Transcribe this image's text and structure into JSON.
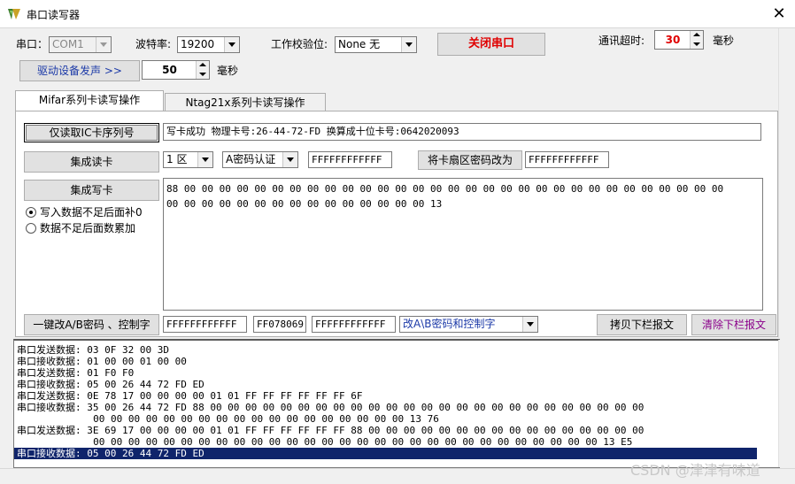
{
  "window": {
    "title": "串口读写器",
    "close_symbol": "✕"
  },
  "serial": {
    "port_label": "串口：",
    "port_value": "COM1",
    "baud_label": "波特率:",
    "baud_value": "19200",
    "parity_label": "工作校验位:",
    "parity_value": "None  无",
    "close_port_label": "关闭串口"
  },
  "timeout": {
    "label": "通讯超时:",
    "value": "30",
    "unit": "毫秒"
  },
  "beep": {
    "button_label": "驱动设备发声 >>",
    "value": "50",
    "unit": "毫秒"
  },
  "tabs": [
    {
      "label": "Mifar系列卡读写操作"
    },
    {
      "label": "Ntag21x系列卡读写操作"
    }
  ],
  "mifare": {
    "read_serial_label": "仅读取IC卡序列号",
    "result_text": "写卡成功 物理卡号:26-44-72-FD 换算成十位卡号:0642020093",
    "read_card_label": "集成读卡",
    "sector_value": "1 区",
    "auth_value": "A密码认证",
    "key_value": "FFFFFFFFFFFF",
    "change_key_label": "将卡扇区密码改为",
    "new_key_value": "FFFFFFFFFFFF",
    "write_card_label": "集成写卡",
    "data_line1": "88 00 00 00 00 00 00 00 00 00 00 00 00 00 00 00 00 00 00 00 00 00 00 00 00 00 00 00 00 00 00 00",
    "data_line2": "00 00 00 00 00 00 00 00 00 00 00 00 00 00 00 13",
    "radio_pad_label": "写入数据不足后面补0",
    "radio_inc_label": "数据不足后面数累加",
    "change_ab_label": "一键改A/B密码 、控制字",
    "key_a_value": "FFFFFFFFFFFF",
    "control_value": "FF078069",
    "key_b_value": "FFFFFFFFFFFF",
    "change_mode_value": "改A\\B密码和控制字",
    "copy_log_label": "拷贝下栏报文",
    "clear_log_label": "清除下栏报文"
  },
  "log": {
    "lines": [
      "串口发送数据: 03 0F 32 00 3D",
      "串口接收数据: 01 00 00 01 00 00",
      "串口发送数据: 01 F0 F0",
      "串口接收数据: 05 00 26 44 72 FD ED",
      "串口发送数据: 0E 78 17 00 00 00 00 01 01 FF FF FF FF FF FF 6F",
      "串口接收数据: 35 00 26 44 72 FD 88 00 00 00 00 00 00 00 00 00 00 00 00 00 00 00 00 00 00 00 00 00 00 00 00 00",
      "             00 00 00 00 00 00 00 00 00 00 00 00 00 00 00 00 00 00 13 76",
      "串口发送数据: 3E 69 17 00 00 00 00 01 01 FF FF FF FF FF FF 88 00 00 00 00 00 00 00 00 00 00 00 00 00 00 00 00",
      "             00 00 00 00 00 00 00 00 00 00 00 00 00 00 00 00 00 00 00 00 00 00 00 00 00 00 00 00 00 13 E5",
      "串口接收数据: 05 00 26 44 72 FD ED"
    ],
    "selected_index": 9
  },
  "watermark": "CSDN @津津有味道"
}
